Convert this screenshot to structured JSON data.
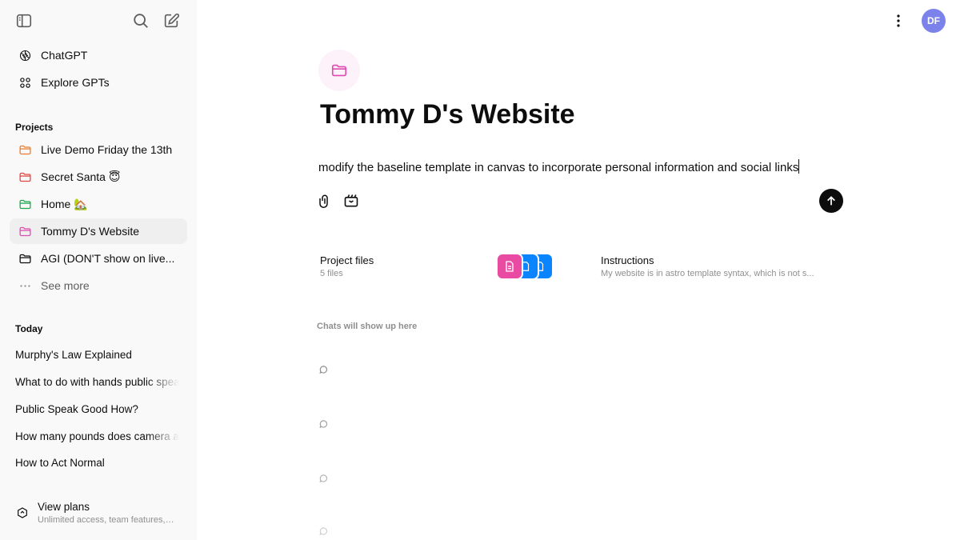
{
  "sidebar": {
    "top_nav": [
      {
        "label": "ChatGPT",
        "icon": "chatgpt-logo-icon"
      },
      {
        "label": "Explore GPTs",
        "icon": "grid-icon"
      }
    ],
    "projects_label": "Projects",
    "projects": [
      {
        "label": "Live Demo Friday the 13th",
        "color": "#f07b2f"
      },
      {
        "label": "Secret Santa 😇",
        "color": "#e2473f"
      },
      {
        "label": "Home 🏡",
        "color": "#1fa64a"
      },
      {
        "label": "Tommy D's Website",
        "color": "#e04bb1",
        "active": true
      },
      {
        "label": "AGI (DON'T show on live...",
        "color": "#0d0d0d"
      }
    ],
    "see_more": "See more",
    "today_label": "Today",
    "chats": [
      "Murphy's Law Explained",
      "What to do with hands public speaking",
      "Public Speak Good How?",
      "How many pounds does camera add",
      "How to Act Normal"
    ],
    "plans_title": "View plans",
    "plans_sub": "Unlimited access, team features, and more"
  },
  "header": {
    "avatar_initials": "DF",
    "avatar_color": "#7b83eb"
  },
  "project": {
    "title": "Tommy D's Website",
    "accent": "#e04bb1",
    "composer_text": "modify the baseline template in canvas to incorporate personal information and social links",
    "files_title": "Project files",
    "files_count": "5 files",
    "instructions_title": "Instructions",
    "instructions_text": "My website is in astro template syntax, which is not s...",
    "chats_placeholder": "Chats will show up here"
  }
}
